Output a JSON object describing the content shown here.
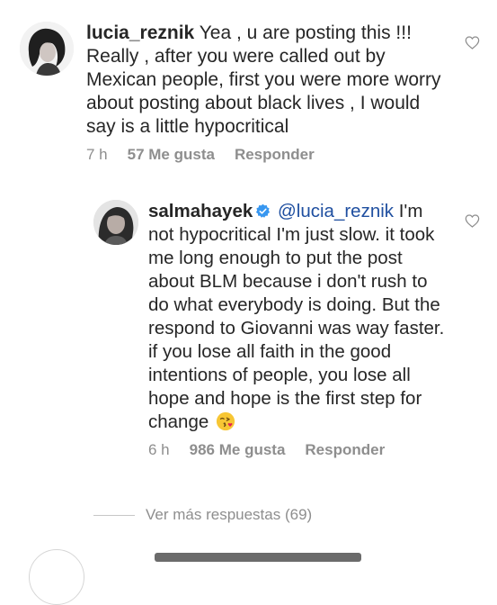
{
  "comment": {
    "username": "lucia_reznik",
    "text": "Yea , u are posting this !!! Really , after you were called out by Mexican people, first you were more worry about posting about black lives , I would say is a little hypocritical",
    "time": "7 h",
    "likes": "57 Me gusta",
    "reply_label": "Responder"
  },
  "reply": {
    "username": "salmahayek",
    "verified": true,
    "mention": "@lucia_reznik",
    "text": "I'm not hypocritical I'm just slow. it took me long enough to put the post about BLM because i don't rush to do what everybody is doing. But the respond to Giovanni was way faster.  if you lose all faith in the good intentions of people, you lose all hope and hope is the first step for change",
    "emoji": "face-blowing-kiss",
    "time": "6 h",
    "likes": "986 Me gusta",
    "reply_label": "Responder"
  },
  "view_more": "Ver más respuestas (69)",
  "icons": {
    "like": "heart-outline-icon",
    "verified": "verified-badge-icon"
  },
  "colors": {
    "mention": "#1f4fa0",
    "verified": "#3897f0",
    "muted": "#8e8e8e",
    "text": "#262626"
  }
}
